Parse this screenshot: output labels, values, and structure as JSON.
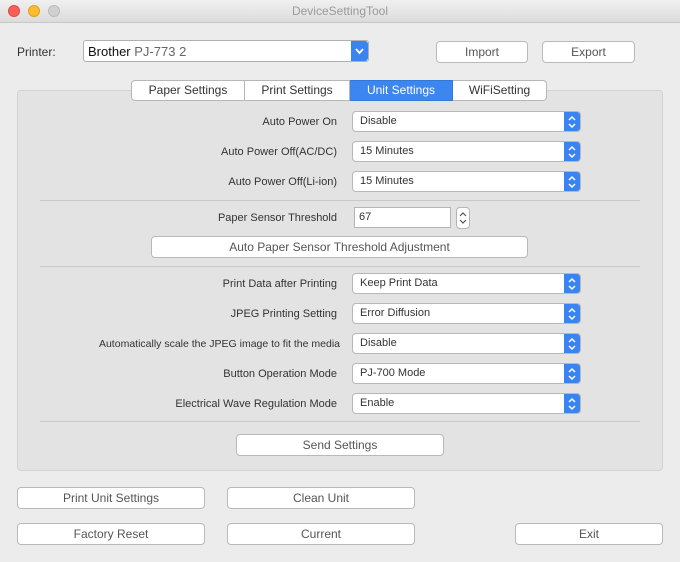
{
  "window": {
    "title": "DeviceSettingTool"
  },
  "printer": {
    "label": "Printer:",
    "value_brand": "Brother",
    "value_model": "PJ-773 2"
  },
  "top_buttons": {
    "import": "Import",
    "export": "Export"
  },
  "tabs": [
    {
      "label": "Paper Settings",
      "active": false
    },
    {
      "label": "Print Settings",
      "active": false
    },
    {
      "label": "Unit Settings",
      "active": true
    },
    {
      "label": "WiFiSetting",
      "active": false
    }
  ],
  "settings": {
    "auto_power_on": {
      "label": "Auto Power On",
      "value": "Disable"
    },
    "auto_power_off_acdc": {
      "label": "Auto Power Off(AC/DC)",
      "value": "15 Minutes"
    },
    "auto_power_off_liion": {
      "label": "Auto Power Off(Li-ion)",
      "value": "15 Minutes"
    },
    "paper_sensor_threshold": {
      "label": "Paper Sensor Threshold",
      "value": "67"
    },
    "auto_threshold_button": "Auto Paper Sensor Threshold Adjustment",
    "print_data_after_printing": {
      "label": "Print Data after Printing",
      "value": "Keep Print Data"
    },
    "jpeg_printing_setting": {
      "label": "JPEG Printing Setting",
      "value": "Error Diffusion"
    },
    "auto_scale_jpeg": {
      "label": "Automatically scale the JPEG image to fit the media",
      "value": "Disable"
    },
    "button_operation_mode": {
      "label": "Button Operation Mode",
      "value": "PJ-700 Mode"
    },
    "electrical_wave_regulation": {
      "label": "Electrical Wave Regulation Mode",
      "value": "Enable"
    },
    "send_settings_button": "Send Settings"
  },
  "bottom_buttons": {
    "print_unit_settings": "Print Unit Settings",
    "clean_unit": "Clean Unit",
    "factory_reset": "Factory Reset",
    "current": "Current",
    "exit": "Exit"
  },
  "colors": {
    "accent": "#3b86ef",
    "panel": "#e3e3e3",
    "window": "#ececec"
  },
  "icons": {
    "close": "close-icon",
    "minimize": "minimize-icon",
    "zoom": "zoom-icon",
    "dropdown": "updown-chevron-icon",
    "stepper": "stepper-icon"
  }
}
